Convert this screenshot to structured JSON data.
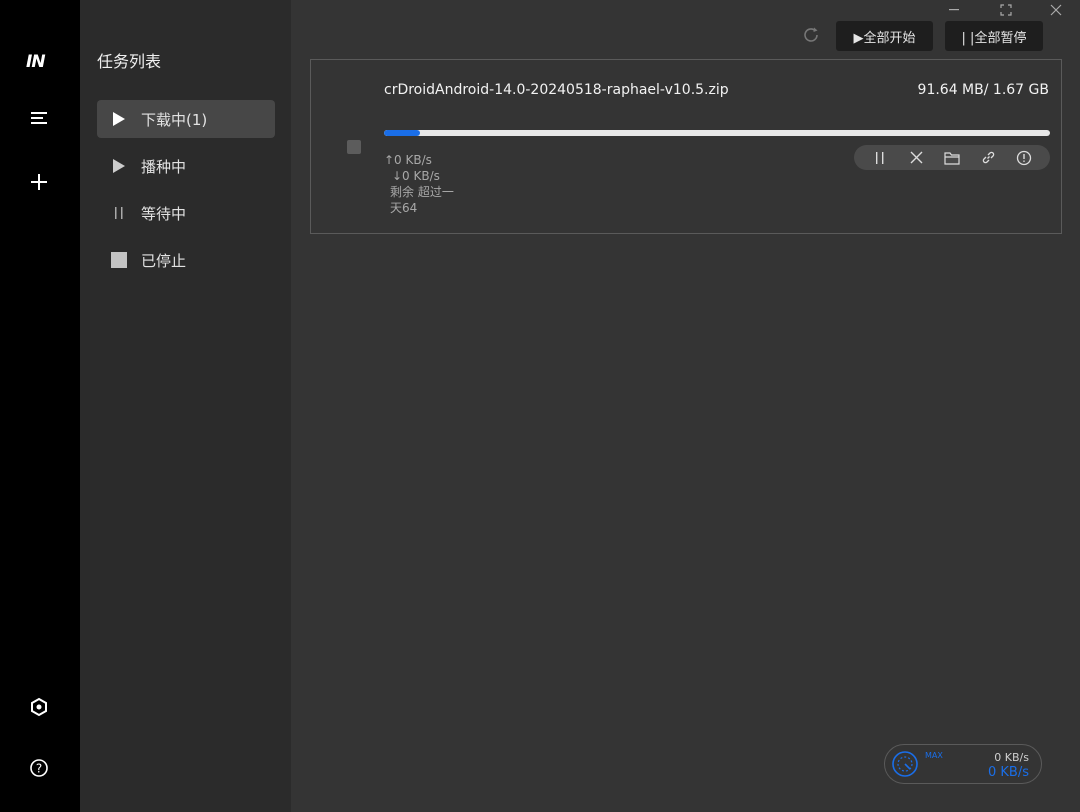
{
  "app": {
    "logo_text": "IN"
  },
  "rail": {
    "icons": [
      "menu-icon",
      "plus-icon",
      "settings-icon",
      "help-icon"
    ]
  },
  "sidebar": {
    "title": "任务列表",
    "items": [
      {
        "label": "下载中(1)",
        "icon": "play-icon",
        "active": true
      },
      {
        "label": "播种中",
        "icon": "play-icon",
        "active": false
      },
      {
        "label": "等待中",
        "icon": "pause-icon",
        "active": false
      },
      {
        "label": "已停止",
        "icon": "stop-icon",
        "active": false
      }
    ]
  },
  "toolbar": {
    "start_all_label": "▶全部开始",
    "pause_all_label": "| |全部暂停"
  },
  "task": {
    "name": "crDroidAndroid-14.0-20240518-raphael-v10.5.zip",
    "size": "91.64 MB/ 1.67 GB",
    "progress": 0.054,
    "upload_speed": "↑0 KB/s",
    "download_speed": "↓0 KB/s",
    "remaining_line1": "剩余 超过一",
    "remaining_line2": "天64"
  },
  "speed_widget": {
    "max_label": "MAX",
    "upload": "0 KB/s",
    "download": "0 KB/s"
  },
  "colors": {
    "accent": "#1a6ee8",
    "rail_bg": "#000000",
    "panel_bg": "#2b2b2b",
    "main_bg": "#343434"
  }
}
